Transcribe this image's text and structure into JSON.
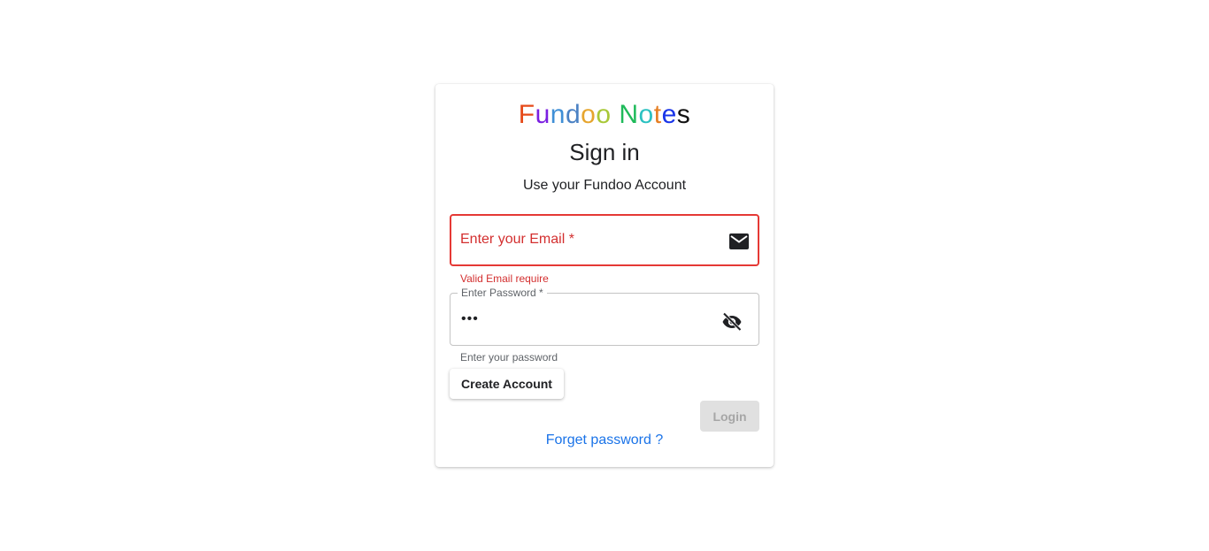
{
  "logo": {
    "letters": [
      "F",
      "u",
      "n",
      "d",
      "o",
      "o",
      " ",
      "N",
      "o",
      "t",
      "e",
      "s"
    ],
    "colors": [
      "#e64a19",
      "#7b1fe0",
      "#3f8fd6",
      "#4b82c4",
      "#e6a52e",
      "#a8c838",
      "#000000",
      "#1fba5a",
      "#2bc1c1",
      "#e67e22",
      "#1a35e8",
      "#111111"
    ]
  },
  "title": "Sign in",
  "subtitle": "Use your Fundoo Account",
  "email": {
    "label": "Enter your Email *",
    "error": "Valid Email require",
    "icon": "mail-icon",
    "error_color": "#d32f2f"
  },
  "password": {
    "label": "Enter Password *",
    "value": "•••",
    "helper": "Enter your password",
    "icon": "visibility-off-icon"
  },
  "buttons": {
    "create_account": "Create Account",
    "login": "Login"
  },
  "forgot_link": "Forget password ?",
  "accent": "#1a73e8"
}
